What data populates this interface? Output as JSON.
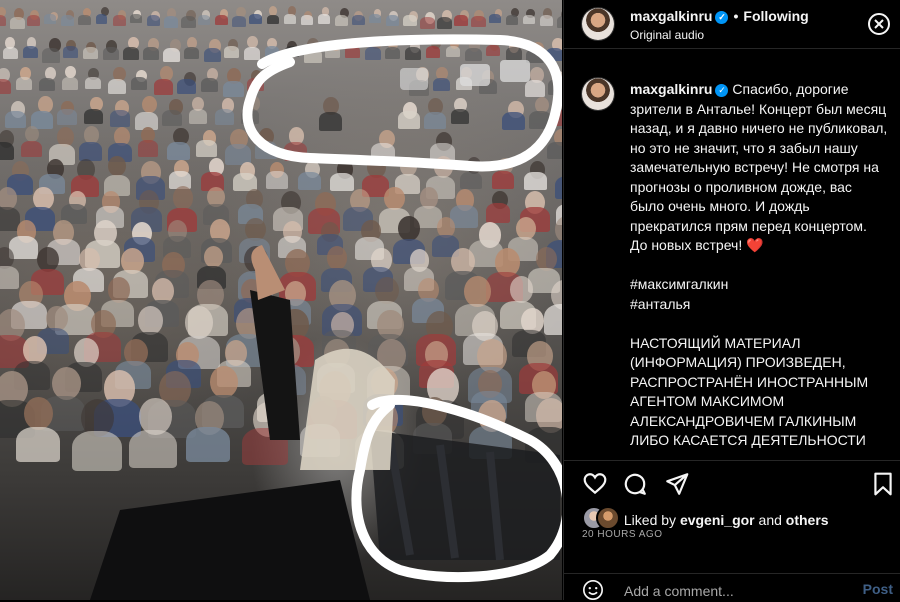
{
  "header": {
    "username": "maxgalkinru",
    "separator": "•",
    "follow_status": "Following",
    "audio": "Original audio"
  },
  "caption": {
    "username": "maxgalkinru",
    "lines": [
      "Спасибо, дорогие зрители в Анталье! Концерт был месяц назад, и я давно ничего не публиковал, но это не значит, что я забыл нашу замечательную встречу! Не смотря на прогнозы о проливном дожде, вас было очень много. И дождь прекратился прям перед концертом. До новых встреч! ❤️"
    ],
    "hashtags": [
      "#максимгалкин",
      "#анталья"
    ],
    "notice": "НАСТОЯЩИЙ МАТЕРИАЛ (ИНФОРМАЦИЯ) ПРОИЗВЕДЕН, РАСПРОСТРАНЁН ИНОСТРАННЫМ АГЕНТОМ МАКСИМОМ АЛЕКСАНДРОВИЧЕМ ГАЛКИНЫМ ЛИБО КАСАЕТСЯ ДЕЯТЕЛЬНОСТИ"
  },
  "likes": {
    "prefix": "Liked by",
    "user": "evgeni_gor",
    "conjunction": "and",
    "others": "others"
  },
  "timestamp": "20 HOURS AGO",
  "comment": {
    "placeholder": "Add a comment...",
    "post_label": "Post"
  },
  "icons": [
    "heart-icon",
    "comment-icon",
    "share-icon",
    "bookmark-icon",
    "emoji-icon",
    "more-icon",
    "verified-badge-icon"
  ],
  "colors": {
    "verified": "#0095f6",
    "post_disabled": "#3f5f86",
    "heart": "#e0245e"
  }
}
